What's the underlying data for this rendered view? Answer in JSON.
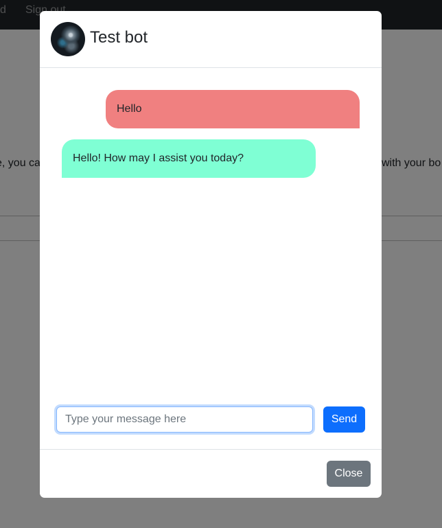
{
  "navbar": {
    "links": [
      "uild",
      "Sign out"
    ]
  },
  "page": {
    "text_left": "e, you ca",
    "text_right": "with your bo"
  },
  "modal": {
    "title": "Test bot",
    "messages": [
      {
        "role": "user",
        "text": "Hello",
        "color": "#f08080"
      },
      {
        "role": "bot",
        "text": "Hello! How may I assist you today?",
        "color": "#7fffd4"
      }
    ],
    "input": {
      "placeholder": "Type your message here",
      "value": ""
    },
    "send_label": "Send",
    "close_label": "Close"
  }
}
